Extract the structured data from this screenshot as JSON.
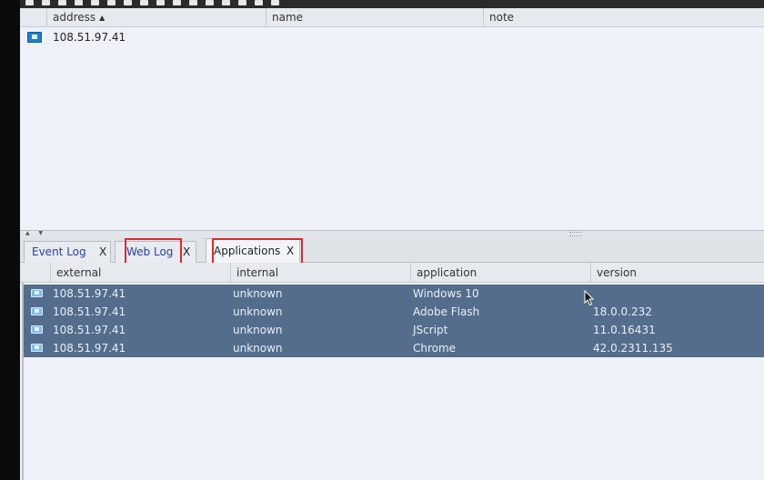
{
  "targets": {
    "columns": [
      "address",
      "name",
      "note"
    ],
    "sort_indicator": "▲",
    "rows": [
      {
        "icon": "monitor-icon",
        "address": "108.51.97.41",
        "name": "",
        "note": ""
      }
    ]
  },
  "tabs": [
    {
      "label": "Event Log",
      "close": "X",
      "active": false,
      "highlighted": false
    },
    {
      "label": "Web Log",
      "close": "X",
      "active": false,
      "highlighted": true
    },
    {
      "label": "Applications",
      "close": "X",
      "active": true,
      "highlighted": true
    }
  ],
  "applications": {
    "columns": [
      "external",
      "internal",
      "application",
      "version"
    ],
    "rows": [
      {
        "icon": "monitor-icon",
        "external": "108.51.97.41",
        "internal": "unknown",
        "application": "Windows 10",
        "version": ""
      },
      {
        "icon": "monitor-icon",
        "external": "108.51.97.41",
        "internal": "unknown",
        "application": "Adobe Flash",
        "version": "18.0.0.232"
      },
      {
        "icon": "monitor-icon",
        "external": "108.51.97.41",
        "internal": "unknown",
        "application": "JScript",
        "version": "11.0.16431"
      },
      {
        "icon": "monitor-icon",
        "external": "108.51.97.41",
        "internal": "unknown",
        "application": "Chrome",
        "version": "42.0.2311.135"
      }
    ]
  },
  "colors": {
    "selected_row": "#556d8c",
    "highlight_box": "#e5262b",
    "tab_link": "#2a3fa8",
    "host_icon": "#1d7fd0"
  }
}
